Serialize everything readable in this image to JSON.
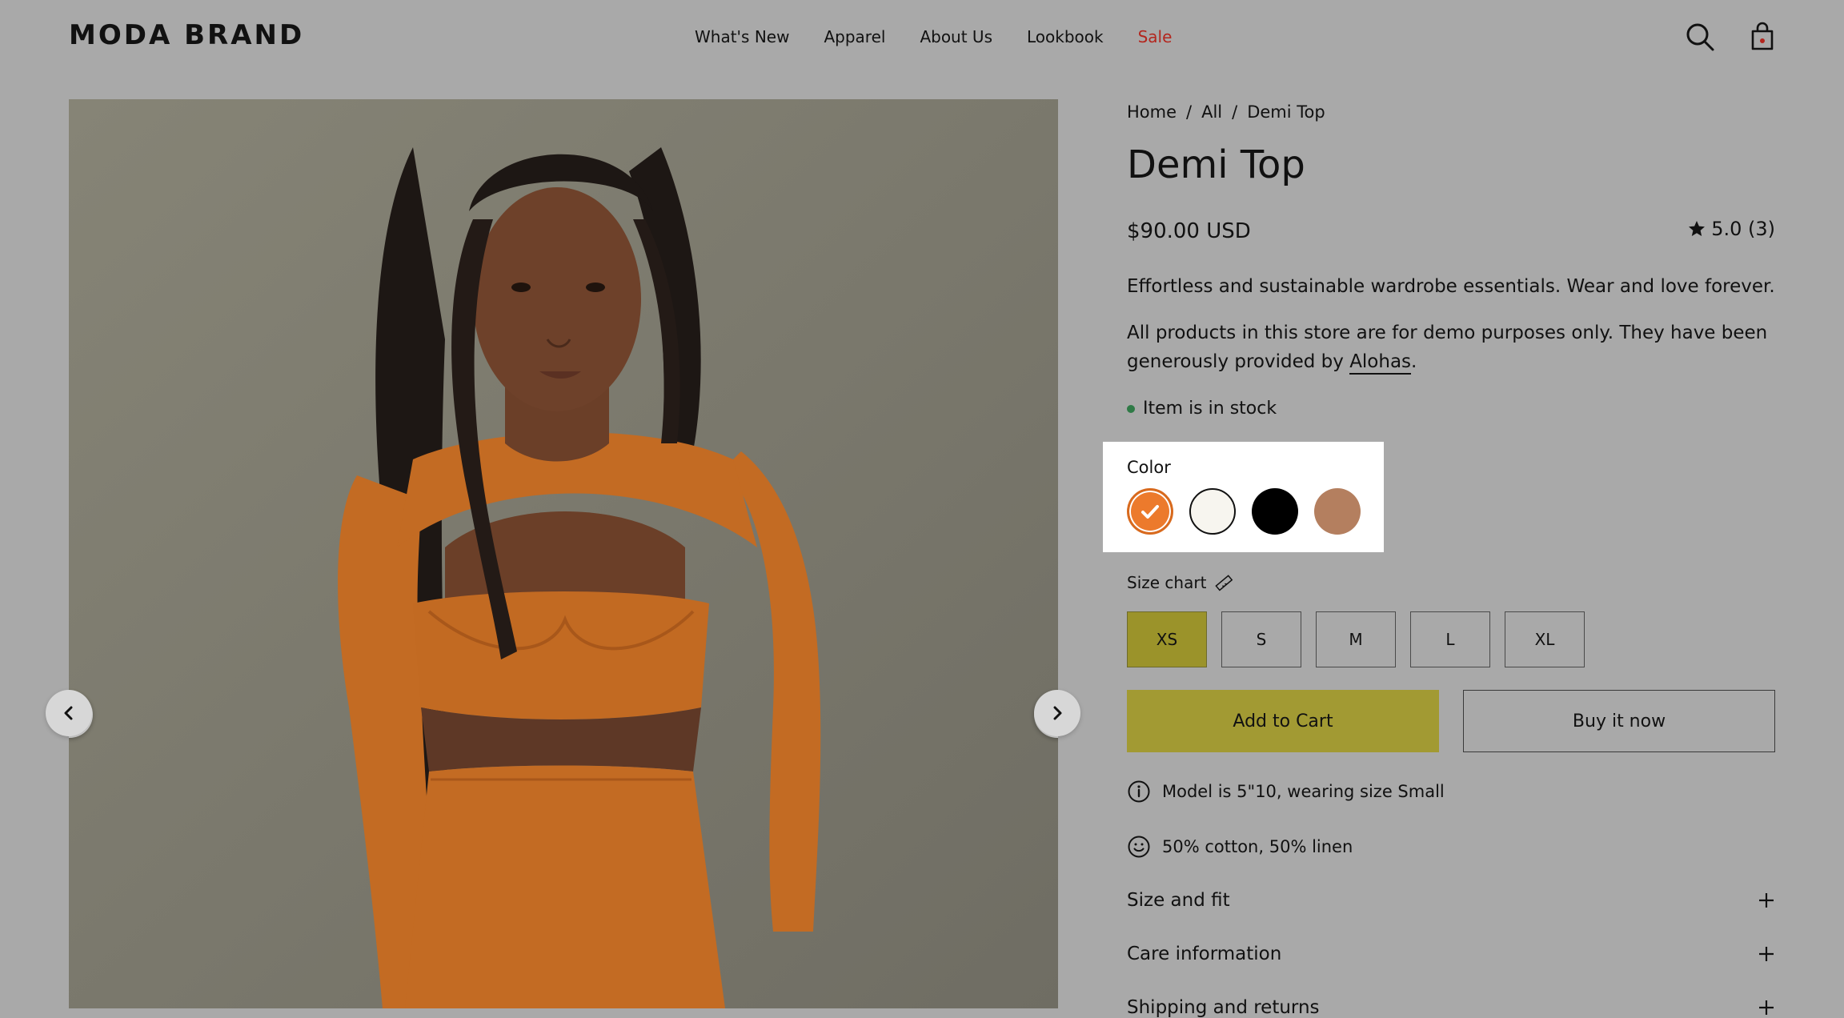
{
  "header": {
    "logo": "MODA BRAND",
    "nav": [
      "What's New",
      "Apparel",
      "About Us",
      "Lookbook",
      "Sale"
    ]
  },
  "breadcrumb": [
    "Home",
    "All",
    "Demi Top"
  ],
  "product": {
    "title": "Demi Top",
    "price": "$90.00 USD",
    "rating": "5.0 (3)",
    "description": "Effortless and sustainable wardrobe essentials. Wear and love forever.",
    "demo_note_before": "All products in this store are for demo purposes only. They have been generously provided by ",
    "demo_note_link": "Alohas",
    "demo_note_after": ".",
    "stock": "Item is in stock"
  },
  "color": {
    "label": "Color",
    "swatches": [
      "#ec7a2c",
      "#f7f5ef",
      "#000000",
      "#b47f5f"
    ],
    "selected_index": 0
  },
  "size": {
    "chart_label": "Size chart",
    "options": [
      "XS",
      "S",
      "M",
      "L",
      "XL"
    ],
    "selected": "XS"
  },
  "actions": {
    "add_to_cart": "Add to Cart",
    "buy_now": "Buy it now"
  },
  "features": [
    "Model is 5\"10, wearing size Small",
    "50% cotton, 50% linen"
  ],
  "accordions": [
    "Size and fit",
    "Care information",
    "Shipping and returns"
  ],
  "colors": {
    "background": "#a9a9a9",
    "accent": "#a29a33",
    "sale": "#b3261e",
    "garment": "#c36b23"
  }
}
